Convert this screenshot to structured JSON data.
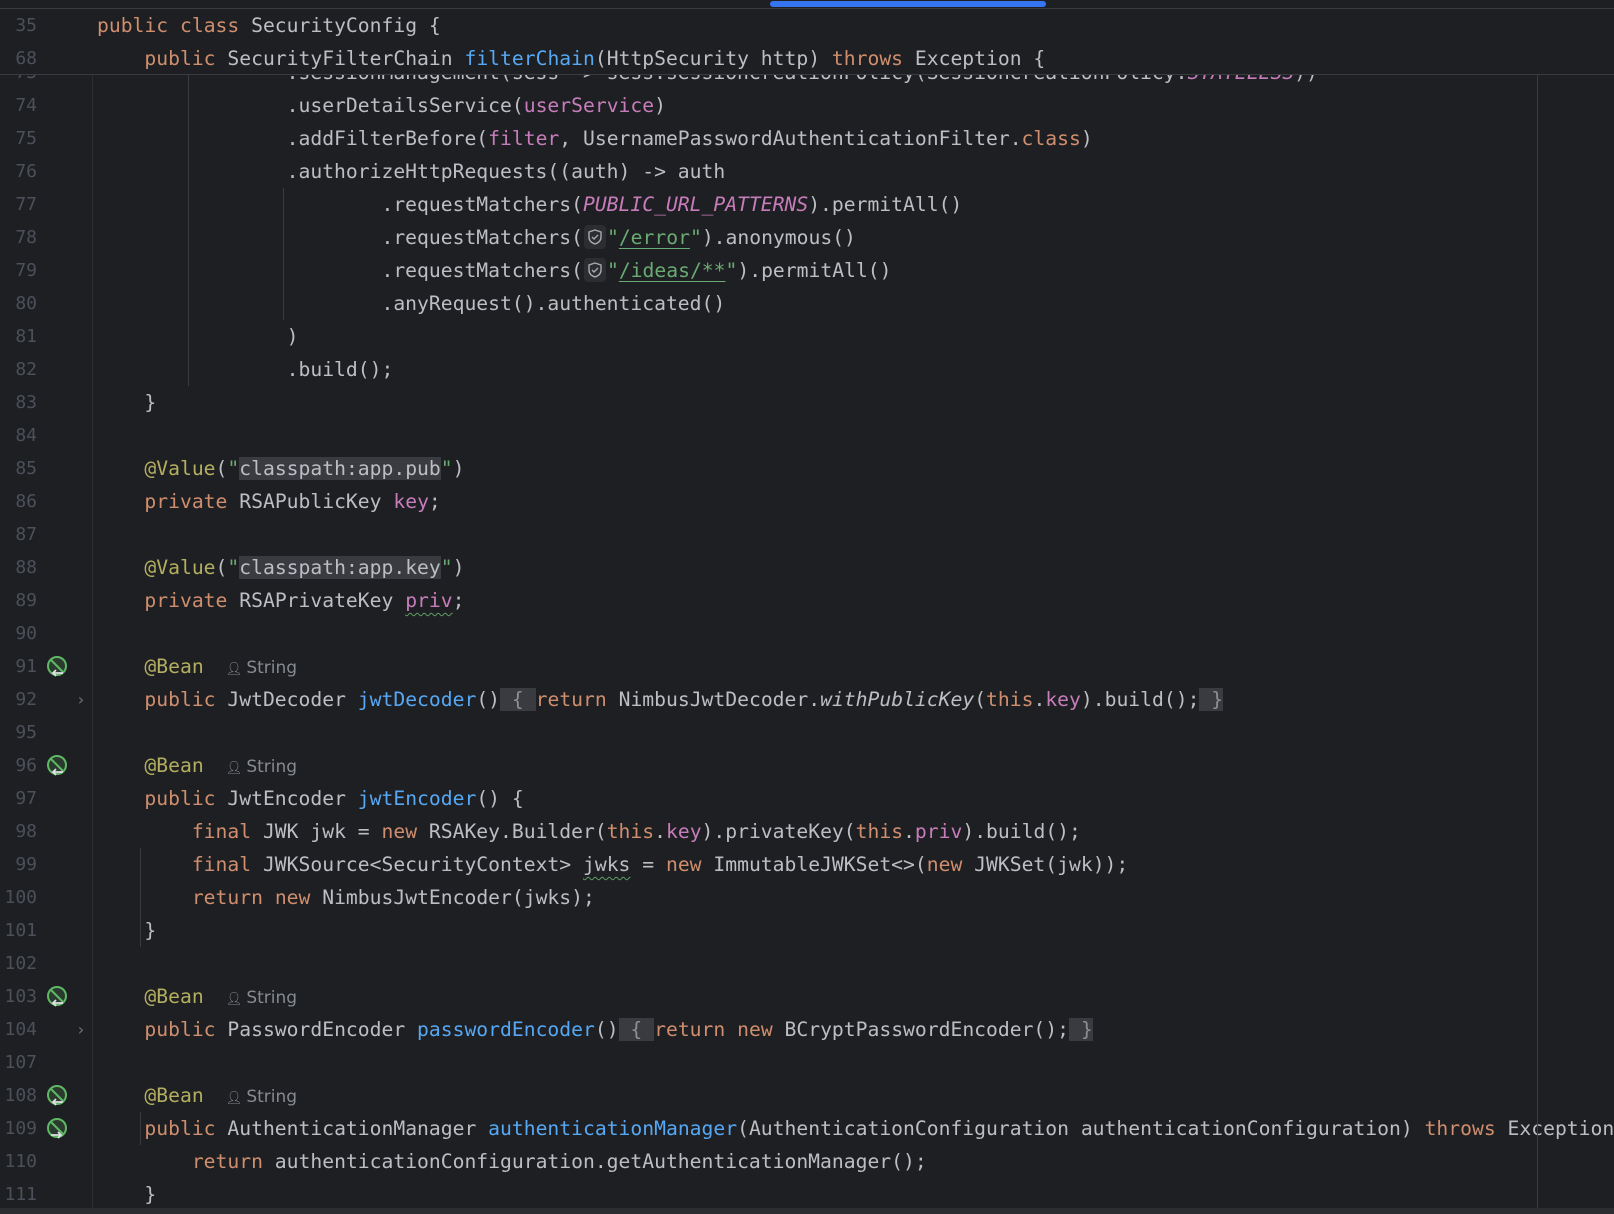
{
  "editor": {
    "scroll_position_note": "horizontal scrollbar",
    "colors": {
      "background": "#1e1f22",
      "keyword": "#cf8e6d",
      "method": "#56a8f5",
      "field": "#c77dbb",
      "string": "#6aab73",
      "annotation": "#b3ae60",
      "scrollbar": "#3574f0"
    }
  },
  "sticky": [
    {
      "num": "35",
      "tokens": [
        {
          "t": "public",
          "c": "k"
        },
        {
          "t": " "
        },
        {
          "t": "class",
          "c": "k"
        },
        {
          "t": " SecurityConfig {"
        }
      ]
    },
    {
      "num": "68",
      "tokens": [
        {
          "t": "    "
        },
        {
          "t": "public",
          "c": "k"
        },
        {
          "t": " SecurityFilterChain "
        },
        {
          "t": "filterChain",
          "c": "d"
        },
        {
          "t": "(HttpSecurity http) "
        },
        {
          "t": "throws",
          "c": "k"
        },
        {
          "t": " Exception {"
        }
      ]
    }
  ],
  "lines": [
    {
      "num": "73",
      "tokens": [
        {
          "t": "                .sessionManagement(sess -> sess.sessionCreationPolicy(SessionCreationPolicy."
        },
        {
          "t": "STATELESS",
          "c": "i"
        },
        {
          "t": "))"
        }
      ]
    },
    {
      "num": "74",
      "tokens": [
        {
          "t": "                .userDetailsService("
        },
        {
          "t": "userService",
          "c": "f"
        },
        {
          "t": ")"
        }
      ]
    },
    {
      "num": "75",
      "tokens": [
        {
          "t": "                .addFilterBefore("
        },
        {
          "t": "filter",
          "c": "f"
        },
        {
          "t": ", UsernamePasswordAuthenticationFilter."
        },
        {
          "t": "class",
          "c": "k"
        },
        {
          "t": ")"
        }
      ]
    },
    {
      "num": "76",
      "tokens": [
        {
          "t": "                .authorizeHttpRequests((auth) -> auth"
        }
      ]
    },
    {
      "num": "77",
      "tokens": [
        {
          "t": "                        .requestMatchers("
        },
        {
          "t": "PUBLIC_URL_PATTERNS",
          "c": "i"
        },
        {
          "t": ").permitAll()"
        }
      ]
    },
    {
      "num": "78",
      "tokens": [
        {
          "t": "                        .requestMatchers("
        },
        {
          "icon": "shield-icon"
        },
        {
          "t": "\"",
          "c": "s"
        },
        {
          "t": "/error",
          "c": "u"
        },
        {
          "t": "\"",
          "c": "s"
        },
        {
          "t": ").anonymous()"
        }
      ]
    },
    {
      "num": "79",
      "tokens": [
        {
          "t": "                        .requestMatchers("
        },
        {
          "icon": "shield-icon"
        },
        {
          "t": "\"",
          "c": "s"
        },
        {
          "t": "/ideas/**",
          "c": "u"
        },
        {
          "t": "\"",
          "c": "s"
        },
        {
          "t": ").permitAll()"
        }
      ]
    },
    {
      "num": "80",
      "tokens": [
        {
          "t": "                        .anyRequest().authenticated()"
        }
      ]
    },
    {
      "num": "81",
      "tokens": [
        {
          "t": "                )"
        }
      ]
    },
    {
      "num": "82",
      "tokens": [
        {
          "t": "                .build();"
        }
      ]
    },
    {
      "num": "83",
      "tokens": [
        {
          "t": "    }"
        }
      ]
    },
    {
      "num": "84",
      "tokens": []
    },
    {
      "num": "85",
      "tokens": [
        {
          "t": "    "
        },
        {
          "t": "@Value",
          "c": "a"
        },
        {
          "t": "("
        },
        {
          "t": "\"",
          "c": "s"
        },
        {
          "t": "classpath:app.pub",
          "c": "h"
        },
        {
          "t": "\"",
          "c": "s"
        },
        {
          "t": ")"
        }
      ]
    },
    {
      "num": "86",
      "tokens": [
        {
          "t": "    "
        },
        {
          "t": "private",
          "c": "k"
        },
        {
          "t": " RSAPublicKey "
        },
        {
          "t": "key",
          "c": "f"
        },
        {
          "t": ";"
        }
      ]
    },
    {
      "num": "87",
      "tokens": []
    },
    {
      "num": "88",
      "tokens": [
        {
          "t": "    "
        },
        {
          "t": "@Value",
          "c": "a"
        },
        {
          "t": "("
        },
        {
          "t": "\"",
          "c": "s"
        },
        {
          "t": "classpath:app.key",
          "c": "h"
        },
        {
          "t": "\"",
          "c": "s"
        },
        {
          "t": ")"
        }
      ]
    },
    {
      "num": "89",
      "tokens": [
        {
          "t": "    "
        },
        {
          "t": "private",
          "c": "k"
        },
        {
          "t": " RSAPrivateKey "
        },
        {
          "t": "priv",
          "c": "f w"
        },
        {
          "t": ";"
        }
      ]
    },
    {
      "num": "90",
      "tokens": []
    },
    {
      "num": "91",
      "gicon": "bean-left",
      "tokens": [
        {
          "t": "    "
        },
        {
          "t": "@Bean",
          "c": "a"
        },
        {
          "inlay": "String"
        }
      ]
    },
    {
      "num": "92",
      "fold": true,
      "tokens": [
        {
          "t": "    "
        },
        {
          "t": "public",
          "c": "k"
        },
        {
          "t": " JwtDecoder "
        },
        {
          "t": "jwtDecoder",
          "c": "d"
        },
        {
          "t": "()"
        },
        {
          "t": " { ",
          "c": "fold"
        },
        {
          "t": "return",
          "c": "k"
        },
        {
          "t": " NimbusJwtDecoder."
        },
        {
          "t": "withPublicKey",
          "c": "m"
        },
        {
          "t": "("
        },
        {
          "t": "this",
          "c": "k"
        },
        {
          "t": "."
        },
        {
          "t": "key",
          "c": "f"
        },
        {
          "t": ").build();"
        },
        {
          "t": " }",
          "c": "fold"
        }
      ]
    },
    {
      "num": "95",
      "tokens": []
    },
    {
      "num": "96",
      "gicon": "bean-left",
      "tokens": [
        {
          "t": "    "
        },
        {
          "t": "@Bean",
          "c": "a"
        },
        {
          "inlay": "String"
        }
      ]
    },
    {
      "num": "97",
      "tokens": [
        {
          "t": "    "
        },
        {
          "t": "public",
          "c": "k"
        },
        {
          "t": " JwtEncoder "
        },
        {
          "t": "jwtEncoder",
          "c": "d"
        },
        {
          "t": "() {"
        }
      ]
    },
    {
      "num": "98",
      "tokens": [
        {
          "t": "        "
        },
        {
          "t": "final",
          "c": "k"
        },
        {
          "t": " JWK jwk = "
        },
        {
          "t": "new",
          "c": "k"
        },
        {
          "t": " RSAKey.Builder("
        },
        {
          "t": "this",
          "c": "k"
        },
        {
          "t": "."
        },
        {
          "t": "key",
          "c": "f"
        },
        {
          "t": ").privateKey("
        },
        {
          "t": "this",
          "c": "k"
        },
        {
          "t": "."
        },
        {
          "t": "priv",
          "c": "f"
        },
        {
          "t": ").build();"
        }
      ]
    },
    {
      "num": "99",
      "tokens": [
        {
          "t": "        "
        },
        {
          "t": "final",
          "c": "k"
        },
        {
          "t": " JWKSource<SecurityContext> "
        },
        {
          "t": "jwks",
          "c": "w"
        },
        {
          "t": " = "
        },
        {
          "t": "new",
          "c": "k"
        },
        {
          "t": " ImmutableJWKSet<>("
        },
        {
          "t": "new",
          "c": "k"
        },
        {
          "t": " JWKSet(jwk));"
        }
      ]
    },
    {
      "num": "100",
      "tokens": [
        {
          "t": "        "
        },
        {
          "t": "return",
          "c": "k"
        },
        {
          "t": " "
        },
        {
          "t": "new",
          "c": "k"
        },
        {
          "t": " NimbusJwtEncoder(jwks);"
        }
      ]
    },
    {
      "num": "101",
      "tokens": [
        {
          "t": "    }"
        }
      ]
    },
    {
      "num": "102",
      "tokens": []
    },
    {
      "num": "103",
      "gicon": "bean-left",
      "tokens": [
        {
          "t": "    "
        },
        {
          "t": "@Bean",
          "c": "a"
        },
        {
          "inlay": "String"
        }
      ]
    },
    {
      "num": "104",
      "fold": true,
      "tokens": [
        {
          "t": "    "
        },
        {
          "t": "public",
          "c": "k"
        },
        {
          "t": " PasswordEncoder "
        },
        {
          "t": "passwordEncoder",
          "c": "d"
        },
        {
          "t": "()"
        },
        {
          "t": " { ",
          "c": "fold"
        },
        {
          "t": "return",
          "c": "k"
        },
        {
          "t": " "
        },
        {
          "t": "new",
          "c": "k"
        },
        {
          "t": " BCryptPasswordEncoder();"
        },
        {
          "t": " }",
          "c": "fold"
        }
      ]
    },
    {
      "num": "107",
      "tokens": []
    },
    {
      "num": "108",
      "gicon": "bean-left",
      "tokens": [
        {
          "t": "    "
        },
        {
          "t": "@Bean",
          "c": "a"
        },
        {
          "inlay": "String"
        }
      ]
    },
    {
      "num": "109",
      "gicon": "bean-right",
      "tokens": [
        {
          "t": "    "
        },
        {
          "t": "public",
          "c": "k"
        },
        {
          "t": " AuthenticationManager "
        },
        {
          "t": "authenticationManager",
          "c": "d"
        },
        {
          "t": "(AuthenticationConfiguration authenticationConfiguration) "
        },
        {
          "t": "throws",
          "c": "k"
        },
        {
          "t": " Exception {"
        }
      ]
    },
    {
      "num": "110",
      "tokens": [
        {
          "t": "        "
        },
        {
          "t": "return",
          "c": "k"
        },
        {
          "t": " authenticationConfiguration.getAuthenticationManager();"
        }
      ]
    },
    {
      "num": "111",
      "tokens": [
        {
          "t": "    }"
        }
      ]
    }
  ]
}
